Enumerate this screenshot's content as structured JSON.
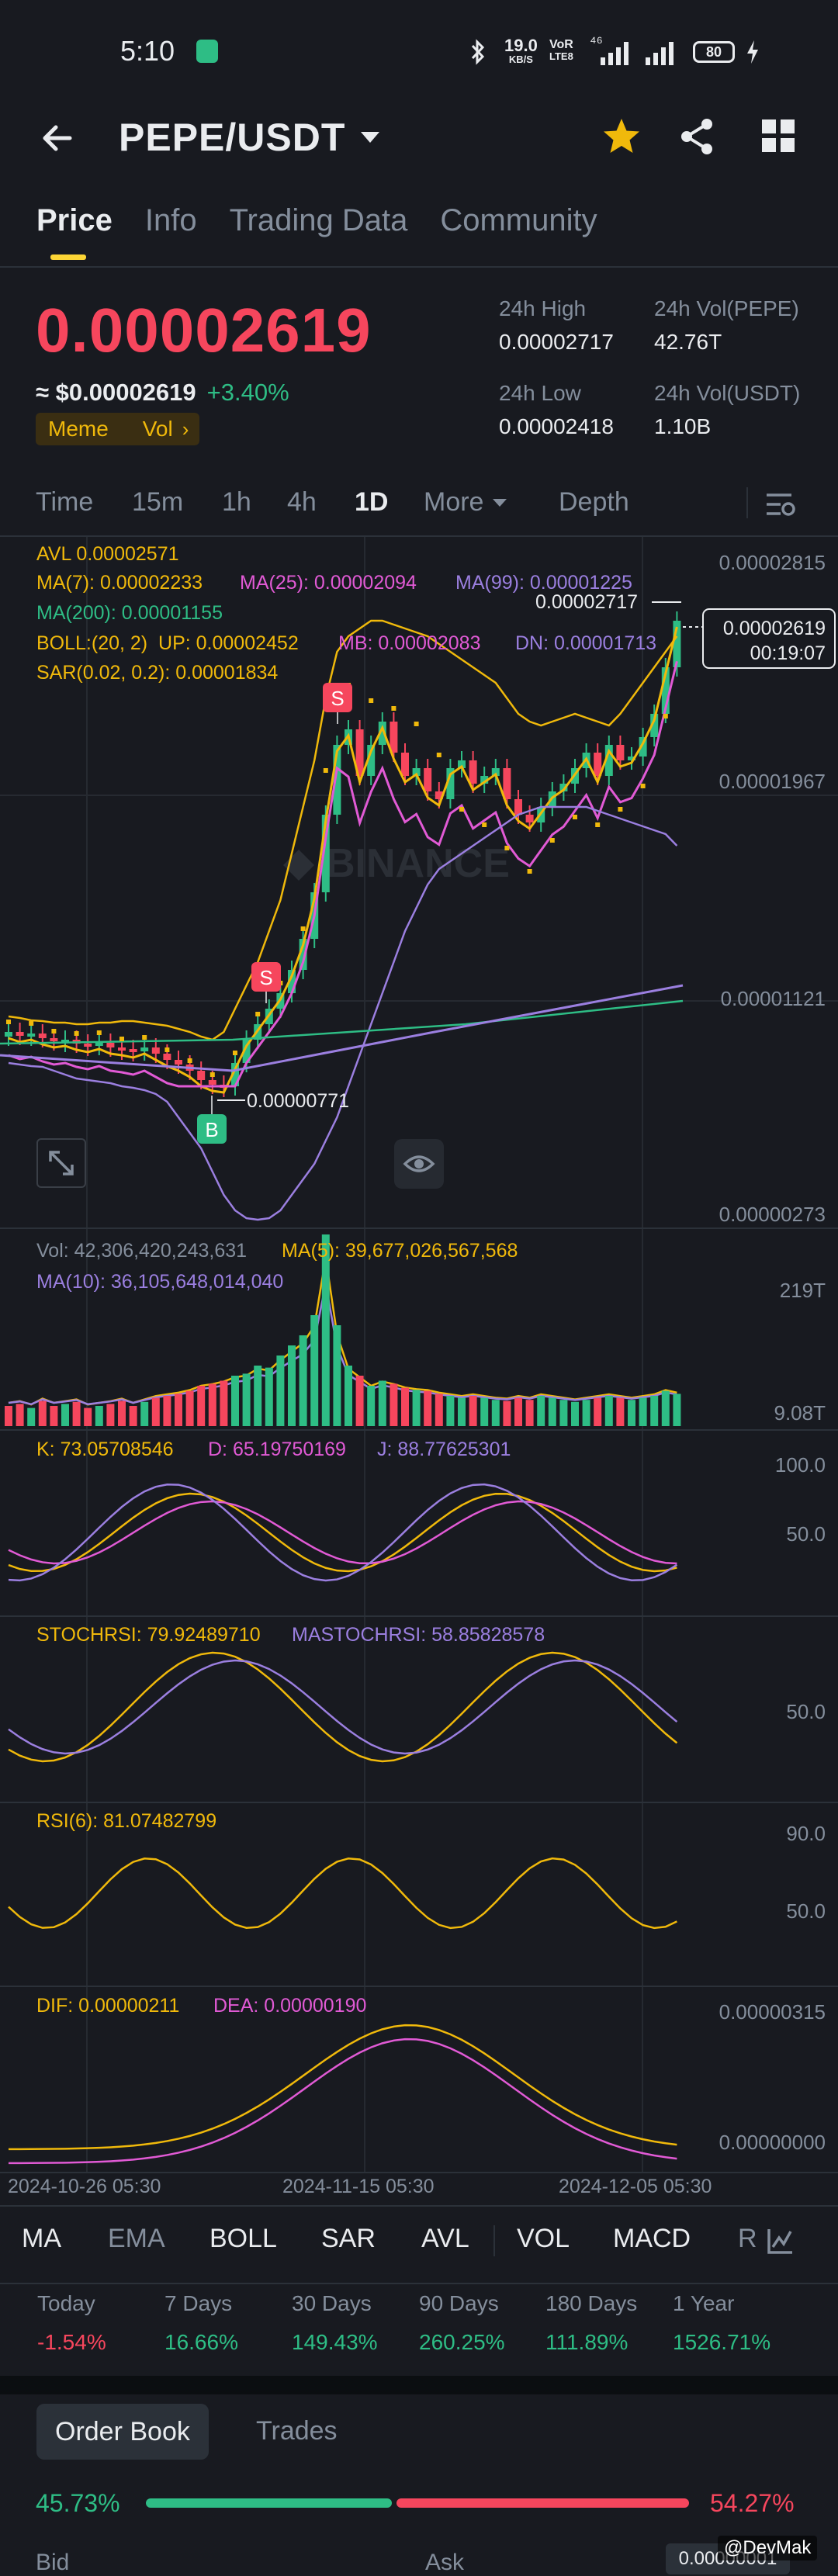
{
  "status_bar": {
    "time": "5:10",
    "net_speed": "19.0",
    "net_unit": "KB/S",
    "volte_top": "VoR",
    "volte_bottom": "LTE8",
    "signal_label": "⁴⁶",
    "battery": "80"
  },
  "header": {
    "pair": "PEPE/USDT"
  },
  "tabs": [
    {
      "label": "Price",
      "active": true
    },
    {
      "label": "Info"
    },
    {
      "label": "Trading Data"
    },
    {
      "label": "Community"
    }
  ],
  "ticker": {
    "price": "0.00002619",
    "usd_price": "≈ $0.00002619",
    "change": "+3.40%",
    "tags": [
      "Meme",
      "Vol"
    ],
    "high_label": "24h High",
    "high_value": "0.00002717",
    "vol_base_label": "24h Vol(PEPE)",
    "vol_base_value": "42.76T",
    "low_label": "24h Low",
    "low_value": "0.00002418",
    "vol_quote_label": "24h Vol(USDT)",
    "vol_quote_value": "1.10B"
  },
  "intervals": [
    {
      "label": "Time"
    },
    {
      "label": "15m"
    },
    {
      "label": "1h"
    },
    {
      "label": "4h"
    },
    {
      "label": "1D",
      "active": true
    },
    {
      "label": "More"
    },
    {
      "label": "Depth"
    }
  ],
  "main_chart": {
    "avl": "AVL 0.00002571",
    "ma7": "MA(7): 0.00002233",
    "ma25": "MA(25): 0.00002094",
    "ma99": "MA(99): 0.00001225",
    "ma200": "MA(200): 0.00001155",
    "boll": "BOLL:(20, 2)  UP: 0.00002452",
    "boll_mb": "MB: 0.00002083",
    "boll_dn": "DN: 0.00001713",
    "sar": "SAR(0.02, 0.2): 0.00001834",
    "y_labels": [
      "0.00002815",
      "0.00001967",
      "0.00001121",
      "0.00000273"
    ],
    "max_label": "0.00002717",
    "min_label": "0.00000771",
    "current_price": "0.00002619",
    "countdown": "00:19:07",
    "watermark": "BINANCE",
    "markers": {
      "sell": "S",
      "buy": "B"
    }
  },
  "volume_panel": {
    "vol": "Vol: 42,306,420,243,631",
    "ma5": "MA(5): 39,677,026,567,568",
    "ma10": "MA(10): 36,105,648,014,040",
    "y_top": "219T",
    "y_bottom": "9.08T"
  },
  "kdj_panel": {
    "k": "K: 73.05708546",
    "d": "D: 65.19750169",
    "j": "J: 88.77625301",
    "y_top": "100.0",
    "y_mid": "50.0"
  },
  "stochrsi_panel": {
    "stoch": "STOCHRSI: 79.92489710",
    "mastoch": "MASTOCHRSI: 58.85828578",
    "y_mid": "50.0"
  },
  "rsi_panel": {
    "rsi": "RSI(6): 81.07482799",
    "y_top": "90.0",
    "y_mid": "50.0"
  },
  "macd_panel": {
    "dif": "DIF: 0.00000211",
    "dea": "DEA: 0.00000190",
    "y_top": "0.00000315",
    "y_bottom": "0.00000000"
  },
  "x_dates": [
    "2024-10-26 05:30",
    "2024-11-15 05:30",
    "2024-12-05 05:30"
  ],
  "indicators": [
    {
      "label": "MA",
      "active": true
    },
    {
      "label": "EMA"
    },
    {
      "label": "BOLL",
      "active": true
    },
    {
      "label": "SAR",
      "active": true
    },
    {
      "label": "AVL",
      "active": true
    },
    {
      "label": "VOL",
      "active": true
    },
    {
      "label": "MACD",
      "active": true
    },
    {
      "label": "RSI"
    }
  ],
  "performance": [
    {
      "period": "Today",
      "value": "-1.54%",
      "dir": "down"
    },
    {
      "period": "7 Days",
      "value": "16.66%",
      "dir": "up"
    },
    {
      "period": "30 Days",
      "value": "149.43%",
      "dir": "up"
    },
    {
      "period": "90 Days",
      "value": "260.25%",
      "dir": "up"
    },
    {
      "period": "180 Days",
      "value": "111.89%",
      "dir": "up"
    },
    {
      "period": "1 Year",
      "value": "1526.71%",
      "dir": "up"
    }
  ],
  "order_tabs": [
    {
      "label": "Order Book",
      "active": true
    },
    {
      "label": "Trades"
    }
  ],
  "order_ratio": {
    "bid_pct": "45.73%",
    "ask_pct": "54.27%",
    "bid_fraction": 0.4573
  },
  "book_header": {
    "bid": "Bid",
    "ask": "Ask",
    "precision": "0.00000001"
  },
  "watermark_user": "@DevMak",
  "colors": {
    "up": "#2ebd85",
    "down": "#f6465d",
    "accent": "#fcd535",
    "bg": "#181a20"
  }
}
